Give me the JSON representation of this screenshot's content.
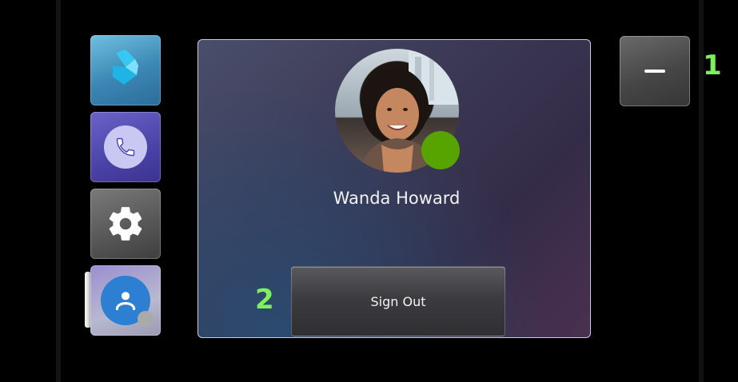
{
  "sidebar": {
    "items": [
      {
        "name": "bing-icon"
      },
      {
        "name": "phone-icon"
      },
      {
        "name": "settings-icon"
      },
      {
        "name": "profile-icon"
      }
    ]
  },
  "profile": {
    "user_name": "Wanda Howard",
    "presence_color": "#57a300",
    "sign_out_label": "Sign Out"
  },
  "window": {
    "minimize_icon": "minus-icon"
  },
  "annotations": {
    "marker_1": "1",
    "marker_2": "2"
  }
}
